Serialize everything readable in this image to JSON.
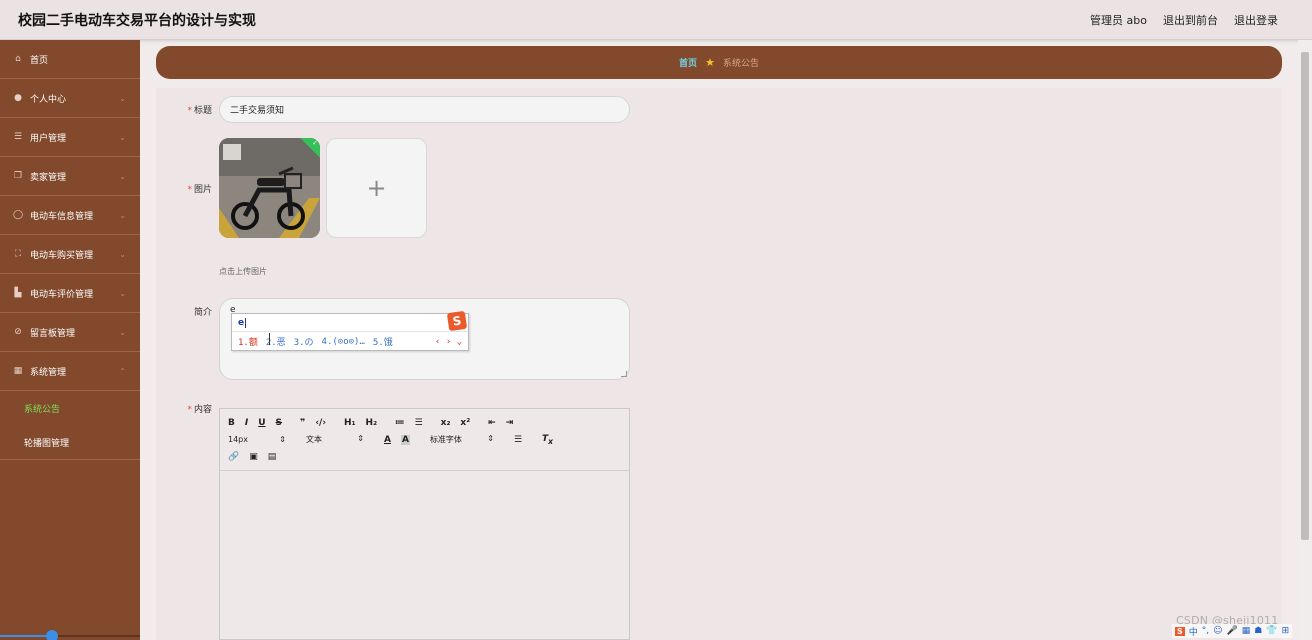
{
  "app": {
    "title": "校园二手电动车交易平台的设计与实现"
  },
  "header": {
    "user_label": "管理员 abo",
    "back_to_front": "退出到前台",
    "logout": "退出登录"
  },
  "sidebar": {
    "items": [
      {
        "label": "首页",
        "icon": "home-icon"
      },
      {
        "label": "个人中心",
        "icon": "user-icon"
      },
      {
        "label": "用户管理",
        "icon": "list-icon"
      },
      {
        "label": "卖家管理",
        "icon": "copy-icon"
      },
      {
        "label": "电动车信息管理",
        "icon": "info-icon"
      },
      {
        "label": "电动车购买管理",
        "icon": "frame-icon"
      },
      {
        "label": "电动车评价管理",
        "icon": "shop-icon"
      },
      {
        "label": "留言板管理",
        "icon": "compass-icon"
      },
      {
        "label": "系统管理",
        "icon": "grid-icon"
      }
    ],
    "submenu": [
      {
        "label": "系统公告",
        "active": true
      },
      {
        "label": "轮播图管理",
        "active": false
      }
    ],
    "accent_active_color": "#7ee05a",
    "background_color": "#82492c"
  },
  "breadcrumb": {
    "home": "首页",
    "current": "系统公告"
  },
  "form": {
    "title_label": "标题",
    "title_value": "二手交易须知",
    "image_label": "图片",
    "upload_hint": "点击上传图片",
    "intro_label": "简介",
    "intro_value": "e",
    "content_label": "内容"
  },
  "ime": {
    "composition": "e",
    "candidates": [
      "1.额",
      "2.恶",
      "3.の",
      "4.(⊙o⊙)…",
      "5.饿"
    ],
    "nav": "‹ › ⌄"
  },
  "editor": {
    "font_size": "14px",
    "format": "文本",
    "font_family": "标准字体",
    "row1": [
      "B",
      "I",
      "U",
      "S",
      "❞",
      "‹/›",
      "H₁",
      "H₂",
      "≔",
      "☰",
      "x₂",
      "x²",
      "⇤",
      "⇥"
    ],
    "row3": [
      "🔗",
      "▣",
      "▤"
    ]
  },
  "watermark": "CSDN @shejj1011",
  "tray": [
    "S",
    "中",
    "°,",
    "☺",
    "🎤",
    "▦",
    "☗",
    "👕",
    "⊞"
  ]
}
